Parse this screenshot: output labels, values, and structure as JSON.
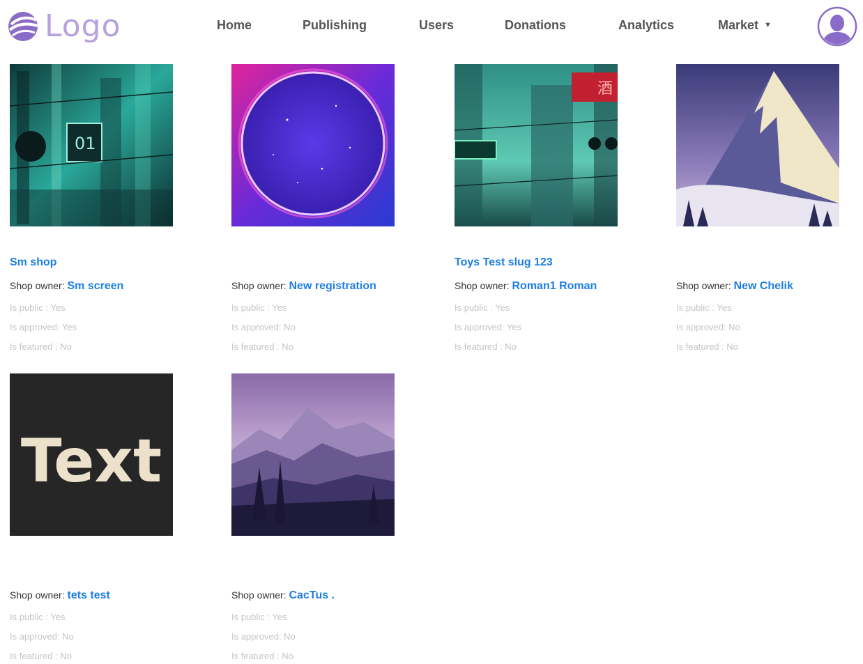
{
  "brand": {
    "logo_text": "Logo",
    "logo_icon": "feather-ball-icon",
    "accent": "#8a6bc8"
  },
  "nav": {
    "items": [
      "Home",
      "Publishing",
      "Users",
      "Donations",
      "Analytics"
    ],
    "market": "Market",
    "avatar_icon": "user-avatar-icon"
  },
  "colors": {
    "link": "#1e7ee3",
    "muted": "#c4c4c4"
  },
  "shops": [
    {
      "name": "Sm shop",
      "owner_label": "Shop owner:",
      "owner": "Sm screen",
      "is_public": "Is public : Yes",
      "is_approved": "Is approved: Yes",
      "is_featured": "Is featured : No",
      "image": "teal-cyberpunk-street"
    },
    {
      "name": "",
      "owner_label": "Shop owner:",
      "owner": "New registration",
      "is_public": "Is public : Yes",
      "is_approved": "Is approved: No",
      "is_featured": "Is featured : No",
      "image": "neon-circle-portal"
    },
    {
      "name": "Toys Test slug 123",
      "owner_label": "Shop owner:",
      "owner": "Roman1 Roman",
      "is_public": "Is public : Yes",
      "is_approved": "Is approved: Yes",
      "is_featured": "Is featured : No",
      "image": "teal-neon-city"
    },
    {
      "name": "",
      "owner_label": "Shop owner:",
      "owner": "New Chelik",
      "is_public": "Is public : Yes",
      "is_approved": "Is approved: No",
      "is_featured": "Is featured : No",
      "image": "snowy-mountain-peak"
    },
    {
      "name": "",
      "owner_label": "Shop owner:",
      "owner": "tets test",
      "is_public": "Is public : Yes",
      "is_approved": "Is approved: No",
      "is_featured": "Is featured : No",
      "image": "text-on-dark",
      "image_text": "Text"
    },
    {
      "name": "",
      "owner_label": "Shop owner:",
      "owner": "CacTus .",
      "is_public": "Is public : Yes",
      "is_approved": "Is approved: No",
      "is_featured": "Is featured : No",
      "image": "purple-mountain-landscape"
    }
  ]
}
